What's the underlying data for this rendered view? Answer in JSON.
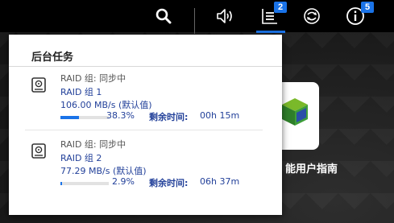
{
  "topbar": {
    "notifications_badge": "2",
    "info_badge": "5",
    "accent_color": "#1a73e8"
  },
  "panel": {
    "title": "后台任务",
    "tasks": [
      {
        "status": "RAID 组: 同步中",
        "name": "RAID 组 1",
        "speed": "106.00 MB/s (默认值)",
        "percent_label": "38.3%",
        "progress": 0.383,
        "remaining_label": "剩余时间:",
        "remaining_value": "00h 15m",
        "icon": "hard-drive-icon"
      },
      {
        "status": "RAID 组: 同步中",
        "name": "RAID 组 2",
        "speed": "77.29 MB/s (默认值)",
        "percent_label": "2.9%",
        "progress": 0.029,
        "remaining_label": "剩余时间:",
        "remaining_value": "06h 37m",
        "icon": "hard-drive-icon"
      }
    ]
  },
  "desktop": {
    "app_label": "能用户指南"
  }
}
